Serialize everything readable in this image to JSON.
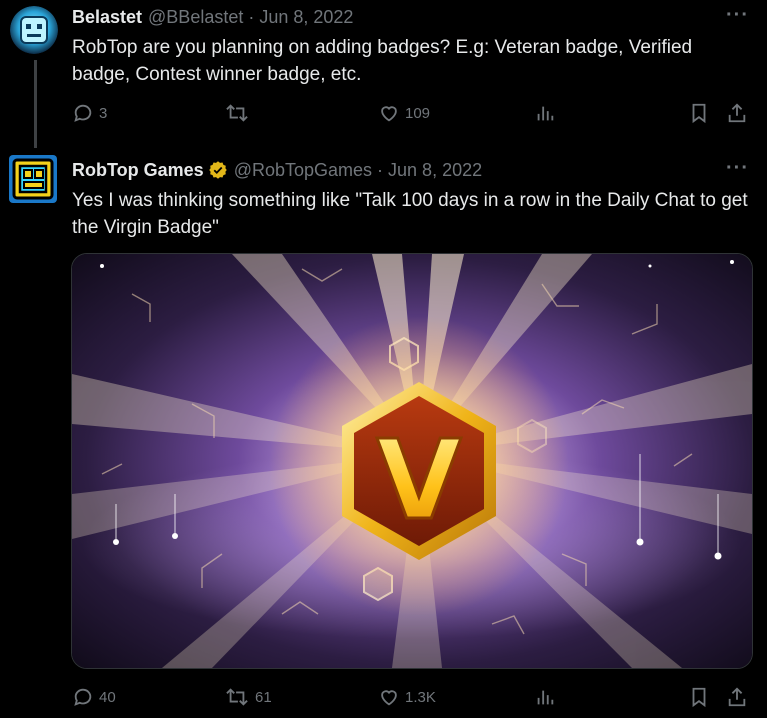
{
  "tweets": [
    {
      "name": "Belastet",
      "handle": "@BBelastet",
      "separator": "·",
      "date": "Jun 8, 2022",
      "text": "RobTop are you planning on adding badges? E.g: Veteran badge, Verified badge, Contest winner badge, etc.",
      "more": "···",
      "stats": {
        "replies": "3",
        "retweets": "",
        "likes": "109"
      }
    },
    {
      "name": "RobTop Games",
      "handle": "@RobTopGames",
      "separator": "·",
      "date": "Jun 8, 2022",
      "text": "Yes I was thinking something like \"Talk 100 days in a row in the Daily Chat to get the Virgin Badge\"",
      "more": "···",
      "verified": true,
      "media": {
        "badge_letter": "V"
      },
      "stats": {
        "replies": "40",
        "retweets": "61",
        "likes": "1.3K"
      }
    }
  ],
  "colors": {
    "background": "#000000",
    "text": "#e7e9ea",
    "muted": "#71767b",
    "verified_gold": "#e2b719"
  },
  "icons": [
    "reply-icon",
    "retweet-icon",
    "like-icon",
    "views-icon",
    "bookmark-icon",
    "share-icon",
    "verified-icon",
    "more-icon"
  ]
}
